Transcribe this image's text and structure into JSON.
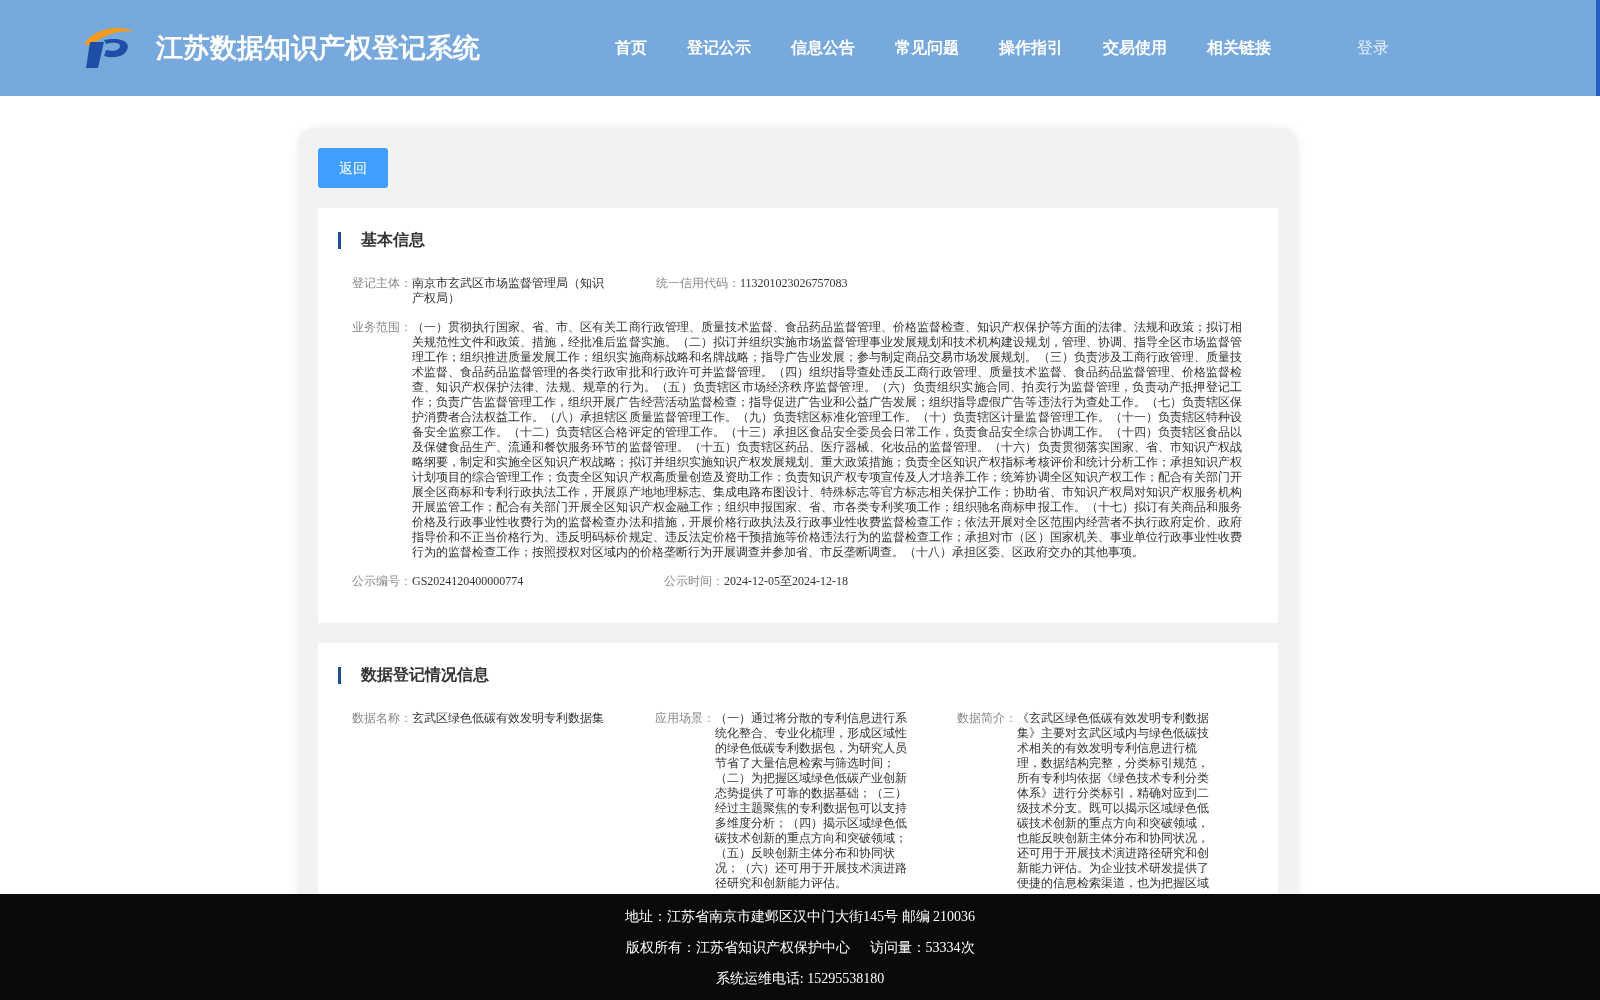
{
  "header": {
    "site_title": "江苏数据知识产权登记系统",
    "nav": [
      {
        "label": "首页",
        "selected": false
      },
      {
        "label": "登记公示",
        "selected": false
      },
      {
        "label": "信息公告",
        "selected": false
      },
      {
        "label": "常见问题",
        "selected": false
      },
      {
        "label": "操作指引",
        "selected": false
      },
      {
        "label": "交易使用",
        "selected": false
      },
      {
        "label": "相关链接",
        "selected": false
      }
    ],
    "login": "登录"
  },
  "back_button": "返回",
  "basic_info": {
    "title": "基本信息",
    "registrant": {
      "label": "登记主体：",
      "value": "南京市玄武区市场监督管理局（知识产权局）"
    },
    "credit_code": {
      "label": "统一信用代码：",
      "value": "113201023026757083"
    },
    "business_scope": {
      "label": "业务范围：",
      "value": "（一）贯彻执行国家、省、市、区有关工商行政管理、质量技术监督、食品药品监督管理、价格监督检查、知识产权保护等方面的法律、法规和政策；拟订相关规范性文件和政策、措施，经批准后监督实施。（二）拟订并组织实施市场监督管理事业发展规划和技术机构建设规划，管理、协调、指导全区市场监督管理工作；组织推进质量发展工作；组织实施商标战略和名牌战略；指导广告业发展；参与制定商品交易市场发展规划。（三）负责涉及工商行政管理、质量技术监督、食品药品监督管理的各类行政审批和行政许可并监督管理。（四）组织指导查处违反工商行政管理、质量技术监督、食品药品监督管理、价格监督检查、知识产权保护法律、法规、规章的行为。（五）负责辖区市场经济秩序监督管理。（六）负责组织实施合同、拍卖行为监督管理，负责动产抵押登记工作；负责广告监督管理工作，组织开展广告经营活动监督检查；指导促进广告业和公益广告发展；组织指导虚假广告等违法行为查处工作。（七）负责辖区保护消费者合法权益工作。（八）承担辖区质量监督管理工作。（九）负责辖区标准化管理工作。（十）负责辖区计量监督管理工作。（十一）负责辖区特种设备安全监察工作。（十二）负责辖区合格评定的管理工作。（十三）承担区食品安全委员会日常工作，负责食品安全综合协调工作。（十四）负责辖区食品以及保健食品生产、流通和餐饮服务环节的监督管理。（十五）负责辖区药品、医疗器械、化妆品的监督管理。（十六）负责贯彻落实国家、省、市知识产权战略纲要，制定和实施全区知识产权战略；拟订并组织实施知识产权发展规划、重大政策措施；负责全区知识产权指标考核评价和统计分析工作；承担知识产权计划项目的综合管理工作；负责全区知识产权高质量创造及资助工作；负责知识产权专项宣传及人才培养工作；统筹协调全区知识产权工作；配合有关部门开展全区商标和专利行政执法工作，开展原产地地理标志、集成电路布图设计、特殊标志等官方标志相关保护工作；协助省、市知识产权局对知识产权服务机构开展监管工作；配合有关部门开展全区知识产权金融工作；组织申报国家、省、市各类专利奖项工作；组织驰名商标申报工作。（十七）拟订有关商品和服务价格及行政事业性收费行为的监督检查办法和措施，开展价格行政执法及行政事业性收费监督检查工作；依法开展对全区范围内经营者不执行政府定价、政府指导价和不正当价格行为、违反明码标价规定、违反法定价格干预措施等价格违法行为的监督检查工作；承担对市（区）国家机关、事业单位行政事业性收费行为的监督检查工作；按照授权对区域内的价格垄断行为开展调查并参加省、市反垄断调查。（十八）承担区委、区政府交办的其他事项。"
    },
    "notice_no": {
      "label": "公示编号：",
      "value": "GS2024120400000774"
    },
    "notice_time": {
      "label": "公示时间：",
      "value": "2024-12-05至2024-12-18"
    }
  },
  "data_info": {
    "title": "数据登记情况信息",
    "data_name": {
      "label": "数据名称：",
      "value": "玄武区绿色低碳有效发明专利数据集"
    },
    "scenario": {
      "label": "应用场景：",
      "value": "（一）通过将分散的专利信息进行系统化整合、专业化梳理，形成区域性的绿色低碳专利数据包，为研究人员节省了大量信息检索与筛选时间；（二）为把握区域绿色低碳产业创新态势提供了可靠的数据基础；（三）经过主题聚焦的专利数据包可以支持多维度分析；（四）揭示区域绿色低碳技术创新的重点方向和突破领域；（五）反映创新主体分布和协同状况；（六）还可用于开展技术演进路径研究和创新能力评估。"
    },
    "summary": {
      "label": "数据简介：",
      "value": "《玄武区绿色低碳有效发明专利数据集》主要对玄武区域内与绿色低碳技术相关的有效发明专利信息进行梳理，数据结构完整，分类标引规范，所有专利均依据《绿色技术专利分类体系》进行分类标引，精确对应到二级技术分支。既可以揭示区域绿色低碳技术创新的重点方向和突破领域，也能反映创新主体分布和协同状况，还可用于开展技术演进路径研究和创新能力评估。为企业技术研发提供了便捷的信息检索渠道，也为把握区域"
    }
  },
  "footer": {
    "address": "地址：江苏省南京市建邺区汉中门大街145号 邮编 210036",
    "copyright": "版权所有：江苏省知识产权保护中心",
    "visits": "访问量：53334次",
    "phone": "系统运维电话: 15295538180"
  }
}
